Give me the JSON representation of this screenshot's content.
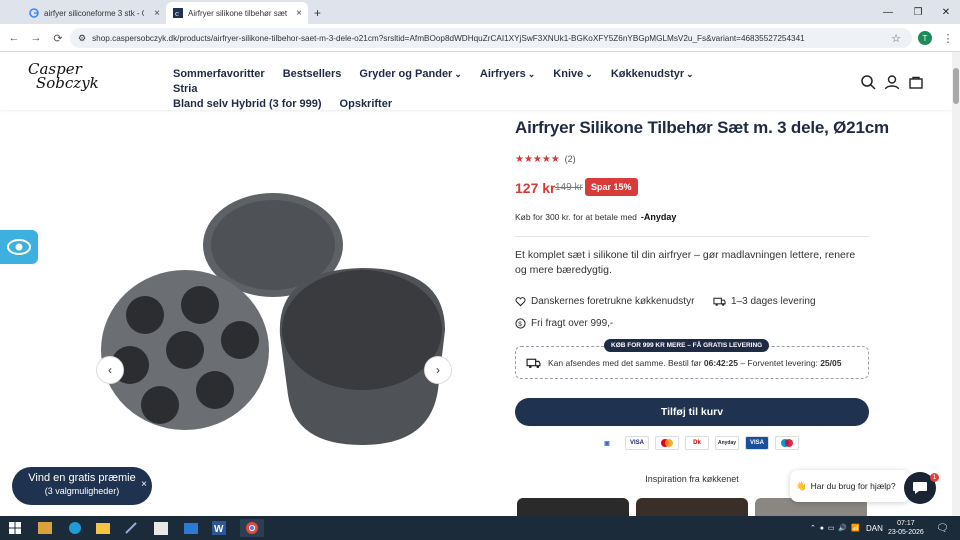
{
  "browser": {
    "tabs": [
      {
        "title": "airfyer siliconeforme 3 stk - Go",
        "active": false
      },
      {
        "title": "Airfryer silikone tilbehør sæt (3",
        "active": true
      }
    ],
    "new_tab": "+",
    "url": "shop.caspersobczyk.dk/products/airfryer-silikone-tilbehor-saet-m-3-dele-o21cm?srsltid=AfmBOop8dWDHquZrCAI1XYjSwF3XNUk1-BGKoXFY5Z6nYBGpMGLMsV2u_Fs&variant=46835527254341",
    "profile_initial": "T"
  },
  "header": {
    "logo": {
      "line1": "Casper",
      "line2": "Sobczyk"
    },
    "nav": [
      {
        "label": "Sommerfavoritter",
        "caret": ""
      },
      {
        "label": "Bestsellers",
        "caret": ""
      },
      {
        "label": "Gryder og Pander",
        "caret": "⌄"
      },
      {
        "label": "Airfryers",
        "caret": "⌄"
      },
      {
        "label": "Knive",
        "caret": "⌄"
      },
      {
        "label": "Køkkenudstyr",
        "caret": "⌄"
      },
      {
        "label": "Stria",
        "caret": ""
      },
      {
        "label": "Bland selv Hybrid (3 for 999)",
        "caret": ""
      },
      {
        "label": "Opskrifter",
        "caret": ""
      }
    ]
  },
  "product": {
    "title": "Airfryer Silikone Tilbehør Sæt m. 3 dele, Ø21cm",
    "rating": 5,
    "review_count": "(2)",
    "price": "127 kr",
    "old_price": "149 kr",
    "save_badge": "Spar 15%",
    "anyday_text": "Køb for 300 kr. for at betale med",
    "anyday_brand": "Anyday",
    "description": "Et komplet sæt i silikone til din airfryer – gør madlavningen lettere, renere og mere bæredygtig.",
    "features": [
      "Danskernes foretrukne køkkenudstyr",
      "1–3 dages levering",
      "Fri fragt over 999,-"
    ],
    "shipping_badge": "KØB FOR 999 KR MERE – FÅ GRATIS LEVERING",
    "shipping_pre": "Kan afsendes med det samme. Bestil før",
    "shipping_time": "06:42:25",
    "shipping_mid": "– Forventet levering:",
    "shipping_date": "25/05",
    "add_to_cart": "Tilføj til kurv",
    "payment_methods": [
      "VISA",
      "MC",
      "Dk",
      "Anyday",
      "VISA",
      "Maestro"
    ],
    "inspiration": "Inspiration fra køkkenet"
  },
  "promo": {
    "line1": "Vind en gratis præmie",
    "line2": "(3 valgmuligheder)",
    "close": "×"
  },
  "chat": {
    "prompt": "Har du brug for hjælp?",
    "emoji": "👋",
    "badge": "1"
  },
  "taskbar": {
    "lang": "DAN",
    "time": "07:17",
    "date": "23-05-2026"
  },
  "colors": {
    "brand_navy": "#1f3350",
    "sale_red": "#d93a3a",
    "star_red": "#d43b33",
    "access_blue": "#3eb0df"
  }
}
